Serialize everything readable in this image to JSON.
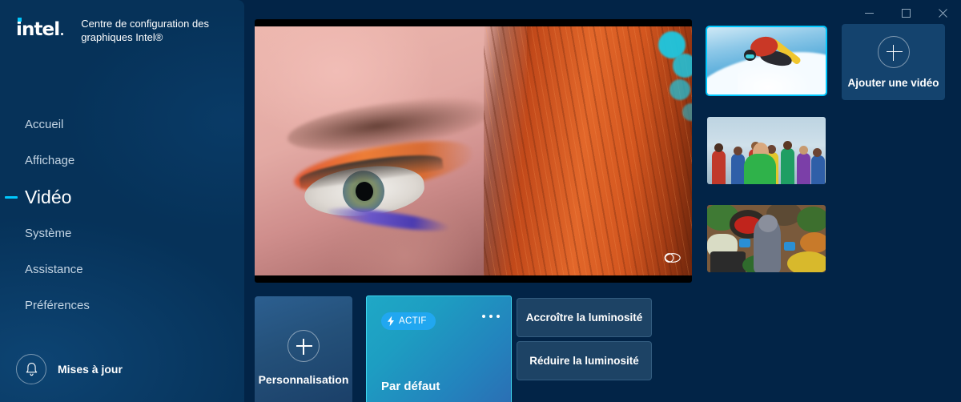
{
  "window": {
    "controls": [
      {
        "name": "minimize",
        "glyph": "minimize-icon",
        "label": "Réduire"
      },
      {
        "name": "maximize",
        "glyph": "maximize-icon",
        "label": "Agrandir"
      },
      {
        "name": "close",
        "glyph": "close-icon",
        "label": "Fermer"
      }
    ]
  },
  "brand": {
    "logo_text": "intel",
    "title": "Centre de configuration des graphiques Intel®",
    "accent": "#00c7fd"
  },
  "sidebar": {
    "background": "#063259",
    "items": [
      {
        "label": "Accueil",
        "active": false
      },
      {
        "label": "Affichage",
        "active": false
      },
      {
        "label": "Vidéo",
        "active": true
      },
      {
        "label": "Système",
        "active": false
      },
      {
        "label": "Assistance",
        "active": false
      },
      {
        "label": "Préférences",
        "active": false
      }
    ],
    "updates": {
      "label": "Mises à jour",
      "icon": "bell-icon"
    }
  },
  "preview": {
    "alt": "Gros plan d'un œil avec maquillage orange et cheveux roux",
    "split_view_icon": "split-compare-icon"
  },
  "thumbnails": [
    {
      "label": "Snowboard",
      "selected": true
    },
    {
      "label": "Groupe de personnes",
      "selected": false
    },
    {
      "label": "Marché",
      "selected": false
    }
  ],
  "add_video": {
    "label": "Ajouter une vidéo",
    "icon": "plus-icon"
  },
  "profiles": {
    "custom": {
      "label": "Personnalisation",
      "icon": "plus-icon"
    },
    "active": {
      "name": "Par défaut",
      "badge": "ACTIF",
      "badge_icon": "lightning-bolt-icon",
      "menu_icon": "more-options-icon",
      "badge_color": "#21a7f0",
      "border_color": "#3fd8f0"
    }
  },
  "actions": [
    {
      "label": "Accroître la luminosité"
    },
    {
      "label": "Réduire la luminosité"
    }
  ]
}
